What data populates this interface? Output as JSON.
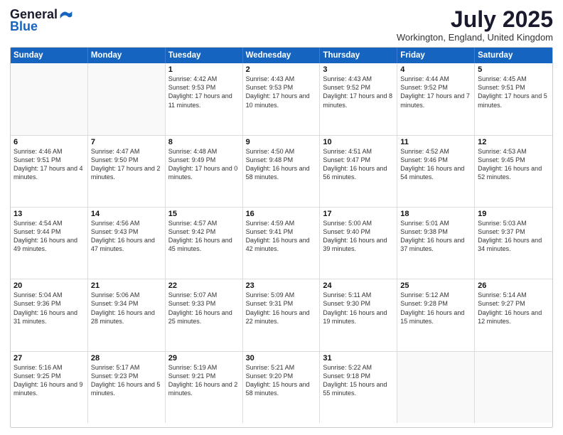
{
  "header": {
    "logo_general": "General",
    "logo_blue": "Blue",
    "month_title": "July 2025",
    "location": "Workington, England, United Kingdom"
  },
  "calendar": {
    "days_of_week": [
      "Sunday",
      "Monday",
      "Tuesday",
      "Wednesday",
      "Thursday",
      "Friday",
      "Saturday"
    ],
    "weeks": [
      [
        {
          "day": "",
          "info": ""
        },
        {
          "day": "",
          "info": ""
        },
        {
          "day": "1",
          "info": "Sunrise: 4:42 AM\nSunset: 9:53 PM\nDaylight: 17 hours and 11 minutes."
        },
        {
          "day": "2",
          "info": "Sunrise: 4:43 AM\nSunset: 9:53 PM\nDaylight: 17 hours and 10 minutes."
        },
        {
          "day": "3",
          "info": "Sunrise: 4:43 AM\nSunset: 9:52 PM\nDaylight: 17 hours and 8 minutes."
        },
        {
          "day": "4",
          "info": "Sunrise: 4:44 AM\nSunset: 9:52 PM\nDaylight: 17 hours and 7 minutes."
        },
        {
          "day": "5",
          "info": "Sunrise: 4:45 AM\nSunset: 9:51 PM\nDaylight: 17 hours and 5 minutes."
        }
      ],
      [
        {
          "day": "6",
          "info": "Sunrise: 4:46 AM\nSunset: 9:51 PM\nDaylight: 17 hours and 4 minutes."
        },
        {
          "day": "7",
          "info": "Sunrise: 4:47 AM\nSunset: 9:50 PM\nDaylight: 17 hours and 2 minutes."
        },
        {
          "day": "8",
          "info": "Sunrise: 4:48 AM\nSunset: 9:49 PM\nDaylight: 17 hours and 0 minutes."
        },
        {
          "day": "9",
          "info": "Sunrise: 4:50 AM\nSunset: 9:48 PM\nDaylight: 16 hours and 58 minutes."
        },
        {
          "day": "10",
          "info": "Sunrise: 4:51 AM\nSunset: 9:47 PM\nDaylight: 16 hours and 56 minutes."
        },
        {
          "day": "11",
          "info": "Sunrise: 4:52 AM\nSunset: 9:46 PM\nDaylight: 16 hours and 54 minutes."
        },
        {
          "day": "12",
          "info": "Sunrise: 4:53 AM\nSunset: 9:45 PM\nDaylight: 16 hours and 52 minutes."
        }
      ],
      [
        {
          "day": "13",
          "info": "Sunrise: 4:54 AM\nSunset: 9:44 PM\nDaylight: 16 hours and 49 minutes."
        },
        {
          "day": "14",
          "info": "Sunrise: 4:56 AM\nSunset: 9:43 PM\nDaylight: 16 hours and 47 minutes."
        },
        {
          "day": "15",
          "info": "Sunrise: 4:57 AM\nSunset: 9:42 PM\nDaylight: 16 hours and 45 minutes."
        },
        {
          "day": "16",
          "info": "Sunrise: 4:59 AM\nSunset: 9:41 PM\nDaylight: 16 hours and 42 minutes."
        },
        {
          "day": "17",
          "info": "Sunrise: 5:00 AM\nSunset: 9:40 PM\nDaylight: 16 hours and 39 minutes."
        },
        {
          "day": "18",
          "info": "Sunrise: 5:01 AM\nSunset: 9:38 PM\nDaylight: 16 hours and 37 minutes."
        },
        {
          "day": "19",
          "info": "Sunrise: 5:03 AM\nSunset: 9:37 PM\nDaylight: 16 hours and 34 minutes."
        }
      ],
      [
        {
          "day": "20",
          "info": "Sunrise: 5:04 AM\nSunset: 9:36 PM\nDaylight: 16 hours and 31 minutes."
        },
        {
          "day": "21",
          "info": "Sunrise: 5:06 AM\nSunset: 9:34 PM\nDaylight: 16 hours and 28 minutes."
        },
        {
          "day": "22",
          "info": "Sunrise: 5:07 AM\nSunset: 9:33 PM\nDaylight: 16 hours and 25 minutes."
        },
        {
          "day": "23",
          "info": "Sunrise: 5:09 AM\nSunset: 9:31 PM\nDaylight: 16 hours and 22 minutes."
        },
        {
          "day": "24",
          "info": "Sunrise: 5:11 AM\nSunset: 9:30 PM\nDaylight: 16 hours and 19 minutes."
        },
        {
          "day": "25",
          "info": "Sunrise: 5:12 AM\nSunset: 9:28 PM\nDaylight: 16 hours and 15 minutes."
        },
        {
          "day": "26",
          "info": "Sunrise: 5:14 AM\nSunset: 9:27 PM\nDaylight: 16 hours and 12 minutes."
        }
      ],
      [
        {
          "day": "27",
          "info": "Sunrise: 5:16 AM\nSunset: 9:25 PM\nDaylight: 16 hours and 9 minutes."
        },
        {
          "day": "28",
          "info": "Sunrise: 5:17 AM\nSunset: 9:23 PM\nDaylight: 16 hours and 5 minutes."
        },
        {
          "day": "29",
          "info": "Sunrise: 5:19 AM\nSunset: 9:21 PM\nDaylight: 16 hours and 2 minutes."
        },
        {
          "day": "30",
          "info": "Sunrise: 5:21 AM\nSunset: 9:20 PM\nDaylight: 15 hours and 58 minutes."
        },
        {
          "day": "31",
          "info": "Sunrise: 5:22 AM\nSunset: 9:18 PM\nDaylight: 15 hours and 55 minutes."
        },
        {
          "day": "",
          "info": ""
        },
        {
          "day": "",
          "info": ""
        }
      ]
    ]
  }
}
